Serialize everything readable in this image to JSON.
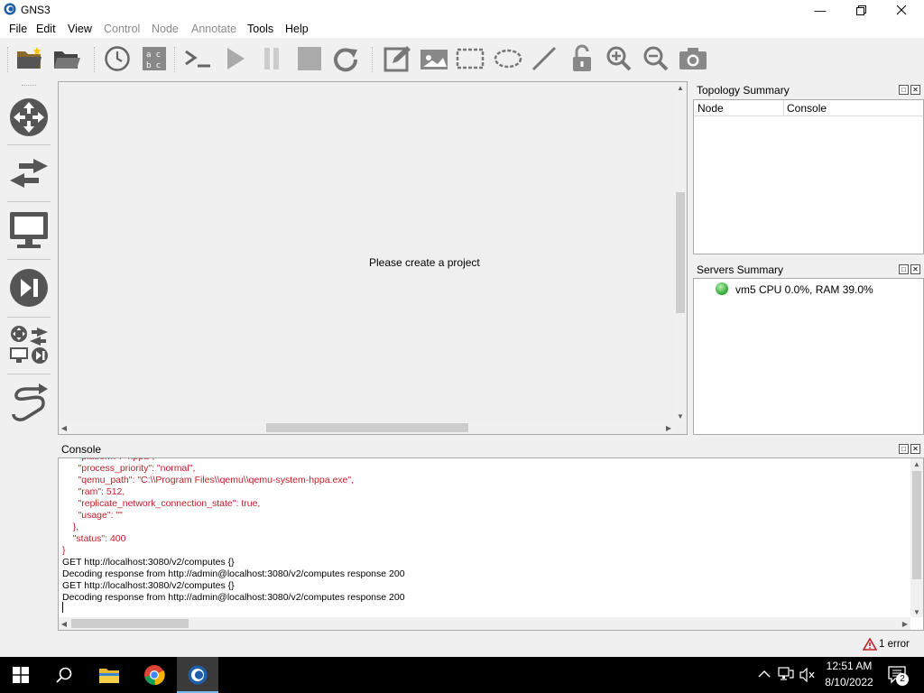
{
  "window": {
    "title": "GNS3"
  },
  "menu": {
    "file": "File",
    "edit": "Edit",
    "view": "View",
    "control": "Control",
    "node": "Node",
    "annotate": "Annotate",
    "tools": "Tools",
    "help": "Help"
  },
  "toolbar_icons": [
    "new-project-icon",
    "open-project-icon",
    "snapshot-clock-icon",
    "show-interface-labels-icon",
    "console-all-icon",
    "start-all-icon",
    "suspend-all-icon",
    "stop-all-icon",
    "reload-all-icon",
    "add-note-icon",
    "insert-picture-icon",
    "draw-rectangle-icon",
    "draw-ellipse-icon",
    "draw-line-icon",
    "lock-unlock-icon",
    "zoom-in-icon",
    "zoom-out-icon",
    "screenshot-icon"
  ],
  "dock_icons": [
    "routers-icon",
    "switches-icon",
    "end-devices-icon",
    "security-devices-icon",
    "all-devices-icon",
    "add-link-icon"
  ],
  "canvas": {
    "message": "Please create a project"
  },
  "topology_summary": {
    "title": "Topology Summary",
    "columns": [
      "Node",
      "Console"
    ]
  },
  "servers_summary": {
    "title": "Servers Summary",
    "server": "vm5 CPU 0.0%, RAM 39.0%",
    "status_color": "#3cb043"
  },
  "console": {
    "title": "Console",
    "lines": [
      {
        "text": "      \"platform\": \"hppa\",",
        "color": "red"
      },
      {
        "text": "      \"process_priority\": \"normal\",",
        "color": "red"
      },
      {
        "text": "      \"qemu_path\": \"C:\\\\Program Files\\\\qemu\\\\qemu-system-hppa.exe\",",
        "color": "red"
      },
      {
        "text": "      \"ram\": 512,",
        "color": "red"
      },
      {
        "text": "      \"replicate_network_connection_state\": true,",
        "color": "red"
      },
      {
        "text": "      \"usage\": \"\"",
        "color": "red"
      },
      {
        "text": "    },",
        "color": "red"
      },
      {
        "text": "    \"status\": 400",
        "color": "red"
      },
      {
        "text": "}",
        "color": "red"
      },
      {
        "text": "GET http://localhost:3080/v2/computes {}",
        "color": "black"
      },
      {
        "text": "Decoding response from http://admin@localhost:3080/v2/computes response 200",
        "color": "black"
      },
      {
        "text": "GET http://localhost:3080/v2/computes {}",
        "color": "black"
      },
      {
        "text": "Decoding response from http://admin@localhost:3080/v2/computes response 200",
        "color": "black"
      }
    ]
  },
  "status": {
    "error_count": "1 error"
  },
  "taskbar": {
    "time": "12:51 AM",
    "date": "8/10/2022",
    "notification_count": "2"
  },
  "colors": {
    "error_red": "#c0202a",
    "accent": "#0078d7"
  }
}
